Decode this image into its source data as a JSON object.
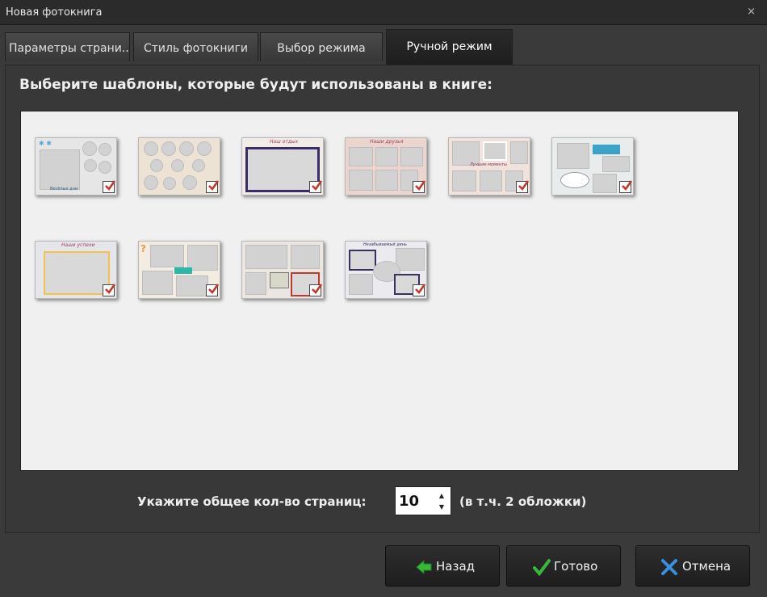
{
  "window": {
    "title": "Новая фотокнига",
    "close_glyph": "×"
  },
  "tabs": [
    {
      "label": "Параметры страни...",
      "active": false
    },
    {
      "label": "Стиль фотокниги",
      "active": false
    },
    {
      "label": "Выбор режима",
      "active": false
    },
    {
      "label": "Ручной режим",
      "active": true
    }
  ],
  "tab_nav": {
    "prev_glyph": "◀",
    "next_glyph": "▶"
  },
  "heading": "Выберите шаблоны, которые будут использованы в книге:",
  "templates": {
    "row1": [
      {
        "title": "",
        "caption": "Весёлые дни",
        "checked": true,
        "border": "#5aa7d0"
      },
      {
        "title": "",
        "caption": "",
        "checked": true,
        "border": "#e8a060"
      },
      {
        "title": "Наш отдых",
        "caption": "",
        "checked": true,
        "border": "#3a2d66"
      },
      {
        "title": "Наши друзья",
        "caption": "",
        "checked": true,
        "border": "#c77a6a"
      },
      {
        "title": "",
        "caption": "Лучшие моменты",
        "checked": true,
        "border": "#8a2a4a"
      },
      {
        "title": "",
        "caption": "",
        "checked": true,
        "border": "#3aa3c7"
      }
    ],
    "row2": [
      {
        "title": "Наши успехи",
        "caption": "",
        "checked": true,
        "border": "#f2c14e"
      },
      {
        "title": "",
        "caption": "",
        "checked": true,
        "border": "#f29a3a"
      },
      {
        "title": "",
        "caption": "",
        "checked": true,
        "border": "#c0392b"
      },
      {
        "title": "Незабываемый день",
        "caption": "",
        "checked": true,
        "border": "#3b2f5e"
      }
    ]
  },
  "pages": {
    "label": "Укажите общее кол-во страниц:",
    "value": "10",
    "note": "(в т.ч. 2 обложки)",
    "up_glyph": "▲",
    "down_glyph": "▼"
  },
  "buttons": {
    "back": {
      "label": "Назад",
      "icon": "arrow-left-icon",
      "color": "#38b83a"
    },
    "done": {
      "label": "Готово",
      "icon": "checkmark-icon",
      "color": "#38b83a"
    },
    "cancel": {
      "label": "Отмена",
      "icon": "x-icon",
      "color": "#3b8fe0"
    }
  }
}
